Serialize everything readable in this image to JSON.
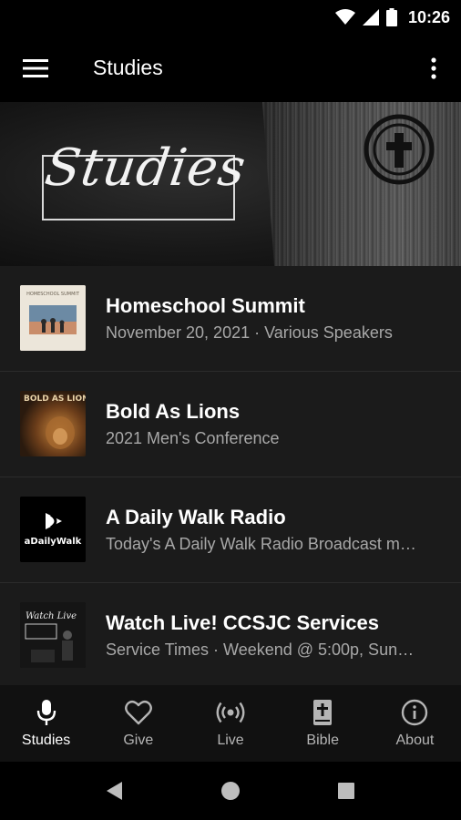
{
  "status_bar": {
    "time": "10:26",
    "icons": [
      "wifi-icon",
      "signal-icon",
      "battery-icon"
    ]
  },
  "app_bar": {
    "title": "Studies",
    "icons": [
      "menu-icon",
      "more-vert-icon"
    ]
  },
  "banner": {
    "script_text": "Studies",
    "logo": "cross-logo-icon"
  },
  "studies": [
    {
      "title": "Homeschool Summit",
      "subtitle": "November 20, 2021 · Various Speakers",
      "thumb_text": "HOMESCHOOL SUMMIT"
    },
    {
      "title": "Bold As Lions",
      "subtitle": "2021 Men's Conference",
      "thumb_text": "BOLD AS LIONS"
    },
    {
      "title": "A Daily Walk Radio",
      "subtitle": "Today's A Daily Walk Radio Broadcast m…",
      "thumb_text": "aDailyWalk"
    },
    {
      "title": "Watch Live! CCSJC Services",
      "subtitle": "Service Times · Weekend @ 5:00p, Sun…",
      "thumb_text": "Watch Live"
    }
  ],
  "bottom_nav": {
    "active": "Studies",
    "items": [
      {
        "label": "Studies",
        "icon": "microphone-icon"
      },
      {
        "label": "Give",
        "icon": "heart-icon"
      },
      {
        "label": "Live",
        "icon": "broadcast-icon"
      },
      {
        "label": "Bible",
        "icon": "bible-icon"
      },
      {
        "label": "About",
        "icon": "info-icon"
      }
    ]
  },
  "colors": {
    "background": "#000000",
    "list_background": "#1b1b1b",
    "subtitle": "#a8a8a8",
    "nav_background": "#111111"
  }
}
